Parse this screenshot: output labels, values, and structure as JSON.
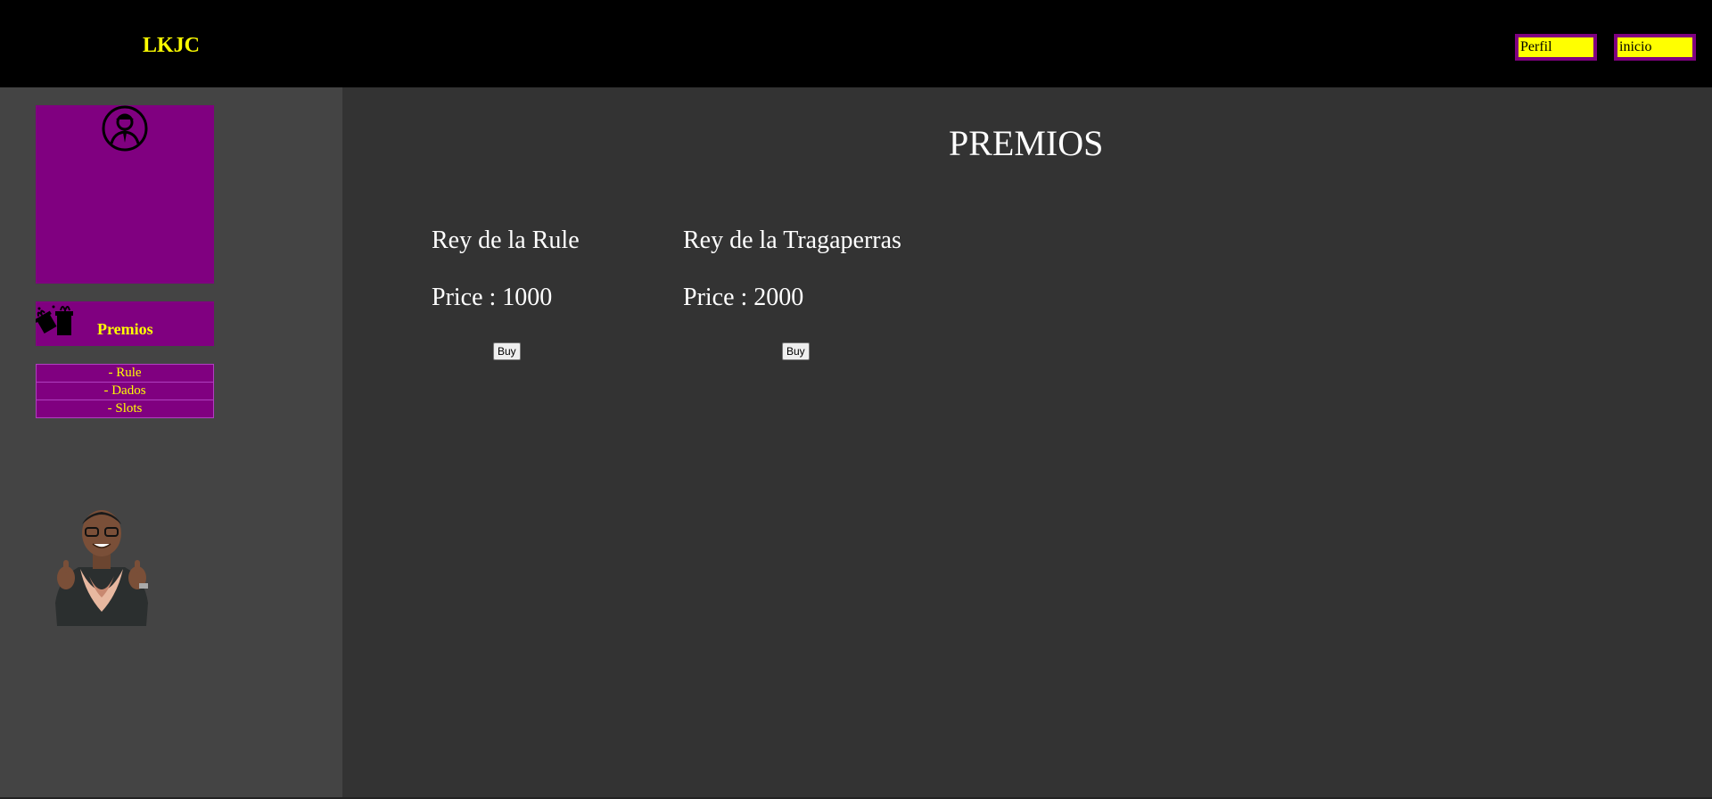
{
  "header": {
    "brand": "LKJC",
    "nav": {
      "perfil": "Perfil",
      "inicio": "inicio"
    }
  },
  "sidebar": {
    "premios_label": "Premios",
    "menu": [
      {
        "label": "- Rule"
      },
      {
        "label": "- Dados"
      },
      {
        "label": "- Slots"
      }
    ]
  },
  "main": {
    "title": "PREMIOS",
    "prizes": [
      {
        "name": "Rey de la Rule",
        "price": "Price : 1000",
        "button": "Buy"
      },
      {
        "name": "Rey de la Tragaperras",
        "price": "Price : 2000",
        "button": "Buy"
      }
    ]
  },
  "colors": {
    "accent_purple": "#800080",
    "accent_yellow": "#ffff00",
    "header_bg": "#000000",
    "sidebar_bg": "#444444",
    "main_bg": "#333333"
  },
  "icons": [
    "user-avatar-icon",
    "gift-icon"
  ]
}
